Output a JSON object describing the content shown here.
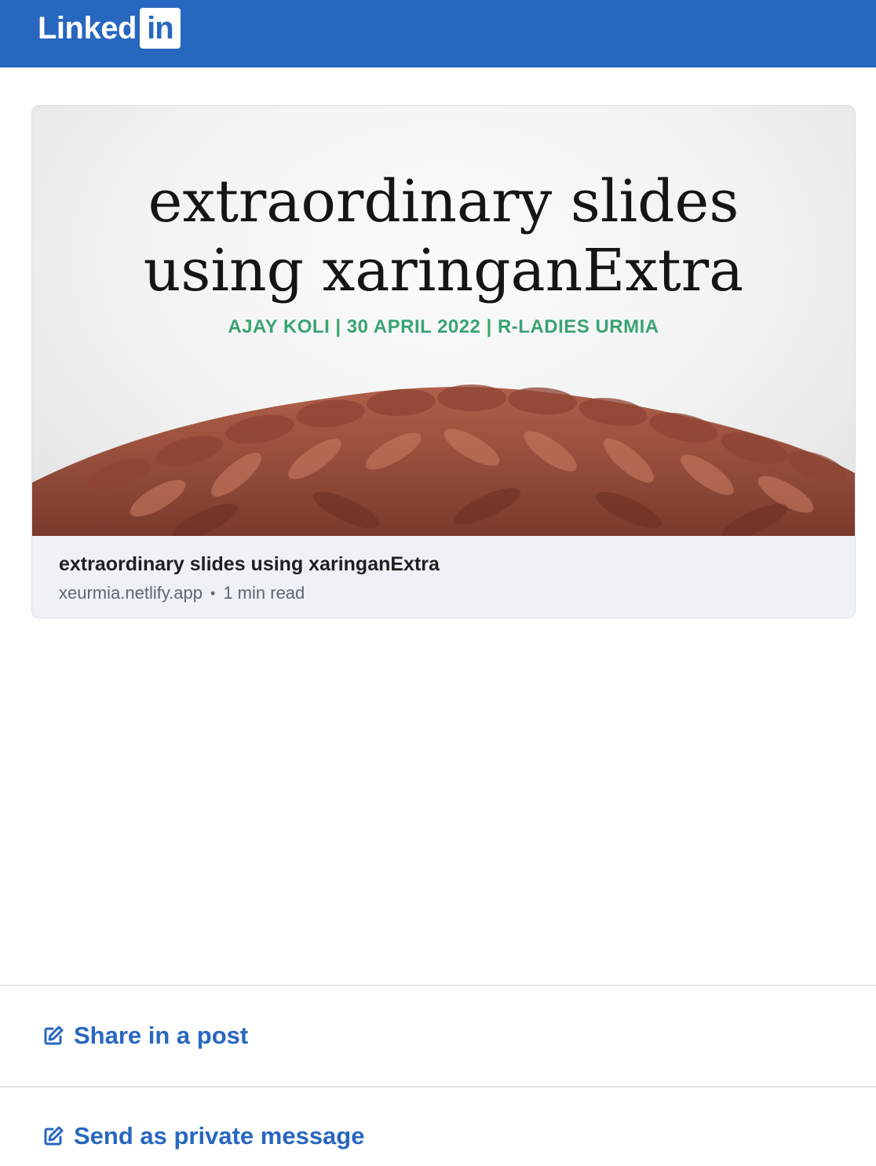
{
  "header": {
    "logo_word": "Linked",
    "logo_box": "in",
    "brand_color": "#2867c0"
  },
  "card": {
    "image": {
      "title_line1": "extraordinary slides",
      "title_line2": "using xaringanExtra",
      "subtitle": "AJAY KOLI | 30 APRIL 2022 | R-LADIES URMIA",
      "subtitle_color": "#3aa374"
    },
    "title": "extraordinary slides using xaringanExtra",
    "domain": "xeurmia.netlify.app",
    "separator": "•",
    "read_time": "1 min read"
  },
  "actions": [
    {
      "label": "Share in a post",
      "icon": "edit-icon"
    },
    {
      "label": "Send as private message",
      "icon": "edit-icon"
    }
  ]
}
